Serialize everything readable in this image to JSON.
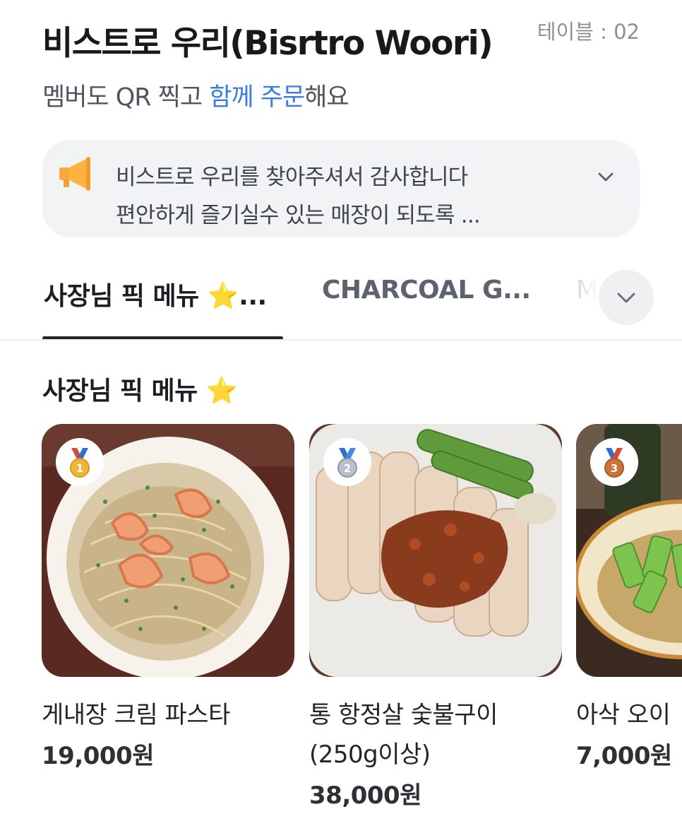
{
  "header": {
    "store_name": "비스트로 우리(Bisrtro Woori)",
    "table_label": "테이블 : 02",
    "subtitle_prefix": "멤버도 QR 찍고 ",
    "subtitle_highlight": "함께 주문",
    "subtitle_suffix": "해요",
    "highlight_color": "#3a7ce0"
  },
  "notice": {
    "icon": "megaphone-icon",
    "line1": "비스트로 우리를 찾아주셔서 감사합니다",
    "line2": "편안하게 즐기실수 있는 매장이 되도록 ..."
  },
  "tabs": [
    {
      "label": "사장님 픽 메뉴 ⭐...",
      "active": true
    },
    {
      "label": "CHARCOAL G...",
      "active": false
    },
    {
      "label": "M",
      "active": false
    }
  ],
  "tabs_more_icon": "chevron-down-icon",
  "section": {
    "title": "사장님 픽 메뉴 ⭐"
  },
  "menu_items": [
    {
      "rank": "1",
      "medal": "gold-medal-icon",
      "name": "게내장 크림 파스타",
      "price": "19,000원"
    },
    {
      "rank": "2",
      "medal": "silver-medal-icon",
      "name": "통 항정살 숯불구이(250g이상)",
      "price": "38,000원"
    },
    {
      "rank": "3",
      "medal": "bronze-medal-icon",
      "name": "아삭 오이",
      "price": "7,000원"
    }
  ]
}
